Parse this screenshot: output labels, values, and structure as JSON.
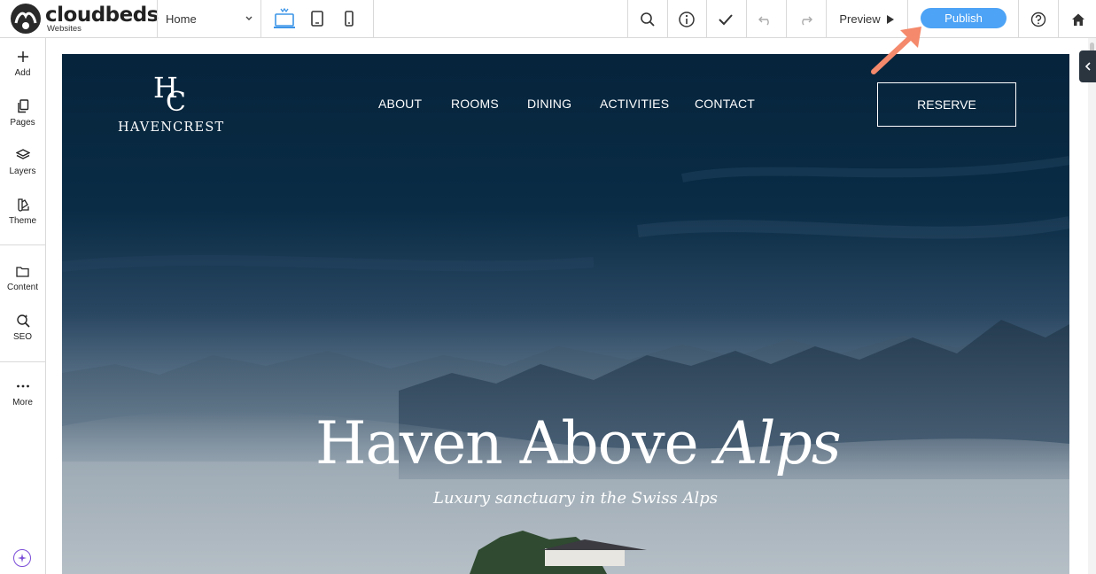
{
  "app": {
    "logo_word": "cloudbeds",
    "logo_sub": "Websites"
  },
  "toolbar": {
    "page_selected": "Home",
    "devices": [
      "desktop-icon",
      "tablet-icon",
      "mobile-icon"
    ],
    "preview_label": "Preview",
    "publish_label": "Publish",
    "accent": "#4da3f5"
  },
  "sidebar": {
    "items": [
      {
        "label": "Add",
        "icon": "plus-icon"
      },
      {
        "label": "Pages",
        "icon": "pages-icon"
      },
      {
        "label": "Layers",
        "icon": "layers-icon"
      },
      {
        "label": "Theme",
        "icon": "theme-icon"
      },
      {
        "label": "Content",
        "icon": "folder-icon"
      },
      {
        "label": "SEO",
        "icon": "seo-icon"
      },
      {
        "label": "More",
        "icon": "more-icon"
      }
    ]
  },
  "site": {
    "brand_name": "HAVENCREST",
    "brand_monogram_1": "H",
    "brand_monogram_2": "C",
    "nav": [
      "ABOUT",
      "ROOMS",
      "DINING",
      "ACTIVITIES",
      "CONTACT"
    ],
    "reserve_label": "RESERVE",
    "headline_main": "Haven Above ",
    "headline_italic": "Alps",
    "tagline": "Luxury sanctuary in the Swiss Alps"
  },
  "annotation": {
    "arrow_color": "#f4896b"
  }
}
